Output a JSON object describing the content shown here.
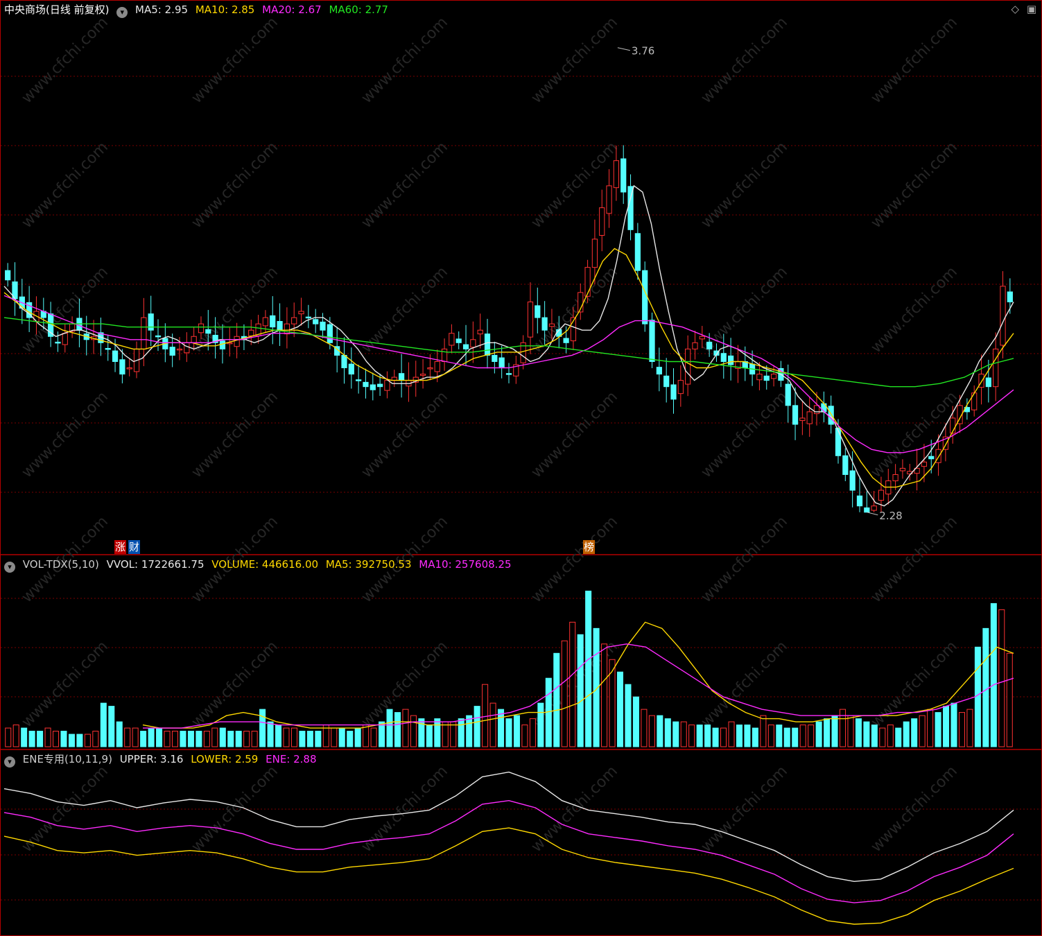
{
  "main_panel": {
    "title": "中央商场(日线 前复权)",
    "indicators": [
      {
        "label": "MA5:",
        "value": "2.95",
        "color": "#e8e8e8"
      },
      {
        "label": "MA10:",
        "value": "2.85",
        "color": "#ffd800"
      },
      {
        "label": "MA20:",
        "value": "2.67",
        "color": "#ff2bff"
      },
      {
        "label": "MA60:",
        "value": "2.77",
        "color": "#22e622"
      }
    ],
    "high_marker": "3.76",
    "low_marker": "2.28",
    "badges": {
      "zhang": "涨",
      "cai": "财",
      "bang": "榜"
    }
  },
  "vol_panel": {
    "name": "VOL-TDX(5,10)",
    "vvol": "VVOL: 1722661.75",
    "volume": "VOLUME: 446616.00",
    "ma5": "MA5: 392750.53",
    "ma10": "MA10: 257608.25"
  },
  "ene_panel": {
    "name": "ENE专用(10,11,9)",
    "upper": "UPPER: 3.16",
    "lower": "LOWER: 2.59",
    "ene": "ENE: 2.88"
  },
  "top_right_icons": [
    "diamond-icon",
    "window-icon"
  ],
  "colors": {
    "up": "#ff3232",
    "down": "#54ffff",
    "ma5": "#e8e8e8",
    "ma10": "#ffd800",
    "ma20": "#ff2bff",
    "ma60": "#22e622",
    "grid": "#7a0000",
    "border": "#b40000"
  },
  "chart_data": [
    {
      "type": "candlestick",
      "title": "中央商场(日线 前复权)",
      "ylim": [
        2.2,
        3.85
      ],
      "high": 3.76,
      "low": 2.28,
      "closes": [
        3.02,
        2.96,
        2.93,
        2.9,
        2.92,
        2.9,
        2.84,
        2.82,
        2.85,
        2.88,
        2.86,
        2.83,
        2.84,
        2.82,
        2.8,
        2.76,
        2.72,
        2.74,
        2.8,
        2.9,
        2.86,
        2.84,
        2.8,
        2.78,
        2.8,
        2.82,
        2.84,
        2.88,
        2.85,
        2.82,
        2.8,
        2.82,
        2.84,
        2.83,
        2.86,
        2.88,
        2.9,
        2.87,
        2.86,
        2.88,
        2.9,
        2.92,
        2.9,
        2.88,
        2.86,
        2.82,
        2.78,
        2.74,
        2.72,
        2.7,
        2.68,
        2.67,
        2.68,
        2.7,
        2.71,
        2.7,
        2.7,
        2.71,
        2.72,
        2.74,
        2.76,
        2.8,
        2.85,
        2.82,
        2.8,
        2.83,
        2.86,
        2.78,
        2.76,
        2.74,
        2.72,
        2.75,
        2.82,
        2.95,
        2.9,
        2.86,
        2.88,
        2.84,
        2.82,
        2.9,
        2.98,
        3.06,
        3.15,
        3.25,
        3.32,
        3.4,
        3.3,
        3.18,
        3.05,
        2.88,
        2.76,
        2.72,
        2.68,
        2.64,
        2.7,
        2.8,
        2.82,
        2.84,
        2.8,
        2.78,
        2.76,
        2.75,
        2.76,
        2.74,
        2.72,
        2.72,
        2.7,
        2.72,
        2.7,
        2.62,
        2.56,
        2.58,
        2.6,
        2.62,
        2.6,
        2.56,
        2.46,
        2.4,
        2.35,
        2.3,
        2.28,
        2.3,
        2.35,
        2.38,
        2.4,
        2.42,
        2.41,
        2.42,
        2.44,
        2.45,
        2.48,
        2.52,
        2.58,
        2.62,
        2.6,
        2.66,
        2.72,
        2.68,
        2.8,
        3.0,
        2.95
      ],
      "series": [
        {
          "name": "MA5",
          "values": [
            3.0,
            2.97,
            2.93,
            2.91,
            2.88,
            2.86,
            2.84,
            2.85,
            2.86,
            2.86,
            2.85,
            2.84,
            2.83,
            2.81,
            2.78,
            2.76,
            2.77,
            2.8,
            2.83,
            2.84,
            2.83,
            2.81,
            2.8,
            2.81,
            2.82,
            2.83,
            2.83,
            2.83,
            2.83,
            2.82,
            2.83,
            2.85,
            2.86,
            2.86,
            2.87,
            2.89,
            2.9,
            2.9,
            2.88,
            2.86,
            2.83,
            2.8,
            2.76,
            2.73,
            2.71,
            2.69,
            2.69,
            2.69,
            2.7,
            2.71,
            2.71,
            2.72,
            2.74,
            2.77,
            2.8,
            2.81,
            2.82,
            2.82,
            2.81,
            2.8,
            2.78,
            2.76,
            2.77,
            2.8,
            2.85,
            2.88,
            2.87,
            2.86,
            2.86,
            2.89,
            2.96,
            3.08,
            3.22,
            3.32,
            3.3,
            3.2,
            3.05,
            2.92,
            2.8,
            2.73,
            2.7,
            2.72,
            2.76,
            2.8,
            2.81,
            2.8,
            2.78,
            2.76,
            2.74,
            2.73,
            2.72,
            2.7,
            2.65,
            2.62,
            2.6,
            2.6,
            2.58,
            2.52,
            2.46,
            2.4,
            2.35,
            2.31,
            2.3,
            2.32,
            2.36,
            2.4,
            2.43,
            2.46,
            2.5,
            2.55,
            2.6,
            2.65,
            2.7,
            2.76,
            2.8,
            2.84,
            2.9,
            2.95
          ]
        },
        {
          "name": "MA10",
          "values": [
            2.98,
            2.95,
            2.92,
            2.9,
            2.88,
            2.86,
            2.85,
            2.84,
            2.83,
            2.82,
            2.81,
            2.8,
            2.8,
            2.81,
            2.82,
            2.82,
            2.82,
            2.81,
            2.81,
            2.82,
            2.83,
            2.84,
            2.85,
            2.86,
            2.86,
            2.86,
            2.85,
            2.83,
            2.81,
            2.78,
            2.75,
            2.73,
            2.71,
            2.7,
            2.7,
            2.7,
            2.7,
            2.71,
            2.73,
            2.75,
            2.77,
            2.78,
            2.79,
            2.79,
            2.79,
            2.8,
            2.81,
            2.83,
            2.86,
            2.92,
            3.0,
            3.08,
            3.12,
            3.1,
            3.03,
            2.95,
            2.87,
            2.8,
            2.76,
            2.74,
            2.74,
            2.75,
            2.76,
            2.76,
            2.75,
            2.74,
            2.73,
            2.72,
            2.7,
            2.66,
            2.62,
            2.56,
            2.5,
            2.44,
            2.39,
            2.36,
            2.36,
            2.37,
            2.38,
            2.42,
            2.48,
            2.55,
            2.62,
            2.68,
            2.74,
            2.8,
            2.85
          ]
        },
        {
          "name": "MA20",
          "values": [
            2.97,
            2.95,
            2.93,
            2.91,
            2.89,
            2.87,
            2.85,
            2.84,
            2.83,
            2.83,
            2.82,
            2.82,
            2.82,
            2.82,
            2.83,
            2.83,
            2.84,
            2.85,
            2.85,
            2.85,
            2.84,
            2.83,
            2.82,
            2.81,
            2.8,
            2.79,
            2.78,
            2.77,
            2.76,
            2.75,
            2.74,
            2.74,
            2.74,
            2.75,
            2.76,
            2.77,
            2.78,
            2.8,
            2.83,
            2.87,
            2.89,
            2.89,
            2.88,
            2.87,
            2.85,
            2.83,
            2.81,
            2.79,
            2.77,
            2.74,
            2.7,
            2.65,
            2.6,
            2.55,
            2.51,
            2.48,
            2.47,
            2.47,
            2.48,
            2.5,
            2.52,
            2.55,
            2.59,
            2.63,
            2.67
          ]
        },
        {
          "name": "MA60",
          "values": [
            2.9,
            2.89,
            2.88,
            2.88,
            2.88,
            2.87,
            2.87,
            2.87,
            2.87,
            2.87,
            2.87,
            2.86,
            2.85,
            2.84,
            2.83,
            2.82,
            2.81,
            2.8,
            2.79,
            2.79,
            2.8,
            2.81,
            2.81,
            2.8,
            2.79,
            2.78,
            2.77,
            2.76,
            2.76,
            2.75,
            2.74,
            2.73,
            2.72,
            2.71,
            2.7,
            2.69,
            2.68,
            2.68,
            2.69,
            2.71,
            2.75,
            2.77
          ]
        }
      ]
    },
    {
      "type": "bar",
      "title": "VOL-TDX(5,10)",
      "values": [
        6,
        7,
        6,
        5,
        5,
        6,
        5,
        5,
        4,
        4,
        4,
        5,
        14,
        13,
        8,
        6,
        6,
        5,
        6,
        6,
        5,
        5,
        5,
        5,
        5,
        5,
        6,
        6,
        5,
        5,
        5,
        5,
        12,
        8,
        7,
        6,
        6,
        5,
        5,
        5,
        7,
        6,
        6,
        5,
        6,
        7,
        6,
        8,
        12,
        11,
        12,
        10,
        9,
        7,
        9,
        8,
        8,
        9,
        10,
        13,
        20,
        14,
        12,
        9,
        10,
        7,
        9,
        14,
        22,
        30,
        34,
        40,
        36,
        50,
        38,
        33,
        28,
        24,
        20,
        16,
        12,
        10,
        10,
        9,
        8,
        8,
        7,
        7,
        7,
        6,
        6,
        8,
        7,
        7,
        6,
        10,
        7,
        7,
        6,
        6,
        7,
        7,
        8,
        9,
        10,
        12,
        10,
        9,
        8,
        7,
        6,
        7,
        6,
        8,
        9,
        10,
        12,
        11,
        13,
        14,
        11,
        12,
        32,
        38,
        46,
        44,
        30
      ],
      "series": [
        {
          "name": "MA5",
          "values": [
            7,
            6,
            6,
            6,
            7,
            10,
            11,
            10,
            8,
            7,
            6,
            6,
            6,
            6,
            7,
            8,
            8,
            7,
            7,
            7,
            8,
            9,
            10,
            11,
            11,
            12,
            14,
            18,
            24,
            33,
            40,
            38,
            32,
            25,
            18,
            14,
            11,
            9,
            9,
            8,
            8,
            9,
            9,
            10,
            10,
            10,
            11,
            12,
            14,
            20,
            26,
            32,
            30
          ]
        },
        {
          "name": "MA10",
          "values": [
            6,
            6,
            6,
            7,
            8,
            8,
            8,
            7,
            7,
            7,
            7,
            7,
            7,
            7,
            8,
            8,
            8,
            9,
            10,
            11,
            13,
            17,
            22,
            28,
            32,
            33,
            32,
            28,
            24,
            20,
            16,
            14,
            12,
            11,
            10,
            10,
            10,
            10,
            10,
            11,
            11,
            12,
            14,
            16,
            20,
            22
          ]
        }
      ]
    },
    {
      "type": "line",
      "title": "ENE专用(10,11,9)",
      "series": [
        {
          "name": "UPPER",
          "values": [
            3.26,
            3.22,
            3.15,
            3.12,
            3.16,
            3.1,
            3.14,
            3.17,
            3.15,
            3.1,
            3.0,
            2.94,
            2.94,
            3.0,
            3.03,
            3.05,
            3.08,
            3.2,
            3.36,
            3.4,
            3.32,
            3.16,
            3.08,
            3.05,
            3.02,
            2.98,
            2.96,
            2.9,
            2.82,
            2.74,
            2.62,
            2.52,
            2.48,
            2.5,
            2.6,
            2.72,
            2.8,
            2.9,
            3.08
          ]
        },
        {
          "name": "ENE",
          "values": [
            3.06,
            3.02,
            2.95,
            2.92,
            2.95,
            2.9,
            2.93,
            2.95,
            2.93,
            2.88,
            2.8,
            2.75,
            2.75,
            2.8,
            2.83,
            2.85,
            2.88,
            2.99,
            3.13,
            3.16,
            3.1,
            2.96,
            2.88,
            2.85,
            2.82,
            2.78,
            2.75,
            2.7,
            2.62,
            2.54,
            2.42,
            2.33,
            2.3,
            2.32,
            2.4,
            2.52,
            2.6,
            2.7,
            2.88
          ]
        },
        {
          "name": "LOWER",
          "values": [
            2.86,
            2.81,
            2.74,
            2.72,
            2.74,
            2.7,
            2.72,
            2.74,
            2.72,
            2.67,
            2.6,
            2.56,
            2.56,
            2.6,
            2.62,
            2.64,
            2.67,
            2.78,
            2.9,
            2.93,
            2.88,
            2.75,
            2.68,
            2.64,
            2.61,
            2.58,
            2.55,
            2.5,
            2.43,
            2.35,
            2.24,
            2.15,
            2.12,
            2.13,
            2.2,
            2.32,
            2.4,
            2.5,
            2.59
          ]
        }
      ]
    }
  ]
}
